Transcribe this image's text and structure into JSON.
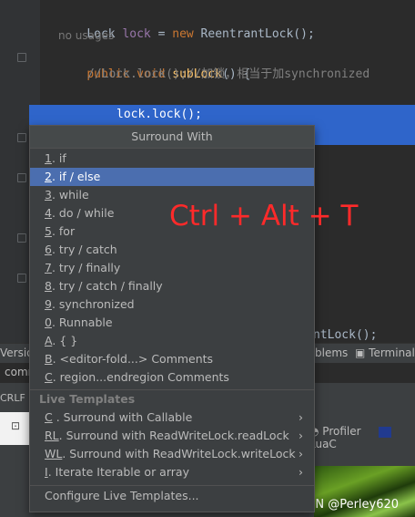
{
  "editor": {
    "line1": {
      "a": "Lock ",
      "b": "lock",
      "c": " = ",
      "d": "new",
      "e": " ReentrantLock();"
    },
    "usages": "no usages",
    "line3": {
      "kw1": "public",
      "kw2": " void ",
      "fn": "subLock",
      "rest": "() {"
    },
    "comment": "//Lock.lock();//加锁，相当于加synchronized",
    "try_kw": "try",
    "try_rest": " {",
    "selected_line": "lock.lock();",
    "tail": "ntLock();"
  },
  "popup": {
    "title": "Surround With",
    "items": [
      {
        "key": "1",
        "label": ". if"
      },
      {
        "key": "2",
        "label": ". if / else",
        "selected": true
      },
      {
        "key": "3",
        "label": ". while"
      },
      {
        "key": "4",
        "label": ". do / while"
      },
      {
        "key": "5",
        "label": ". for"
      },
      {
        "key": "6",
        "label": ". try / catch"
      },
      {
        "key": "7",
        "label": ". try / finally"
      },
      {
        "key": "8",
        "label": ". try / catch / finally"
      },
      {
        "key": "9",
        "label": ". synchronized"
      },
      {
        "key": "0",
        "label": ". Runnable"
      },
      {
        "key": "A",
        "label": ". { }"
      },
      {
        "key": "B",
        "label": ". <editor-fold...> Comments"
      },
      {
        "key": "C",
        "label": ". region...endregion Comments"
      }
    ],
    "live_templates_header": "Live Templates",
    "live_templates": [
      {
        "key": "C",
        "label": " . Surround with Callable"
      },
      {
        "key": "RL",
        "label": ". Surround with ReadWriteLock.readLock"
      },
      {
        "key": "WL",
        "label": ". Surround with ReadWriteLock.writeLock"
      },
      {
        "key": "I",
        "label": ". Iterate Iterable or array"
      }
    ],
    "configure": "Configure Live Templates..."
  },
  "bottom": {
    "version_tab": "Version",
    "problems_tab": "blems",
    "terminal_tab": "Terminal",
    "term_text": "comm",
    "crlf": "CRLF",
    "profiler": "Profiler",
    "luac": "LuaC"
  },
  "overlay_text": "Ctrl + Alt + T",
  "watermark": "CSDN @Perley620",
  "colors": {
    "selection": "#2f65ca",
    "popup_selected": "#4b6eaf",
    "overlay": "#ff2a2a"
  }
}
